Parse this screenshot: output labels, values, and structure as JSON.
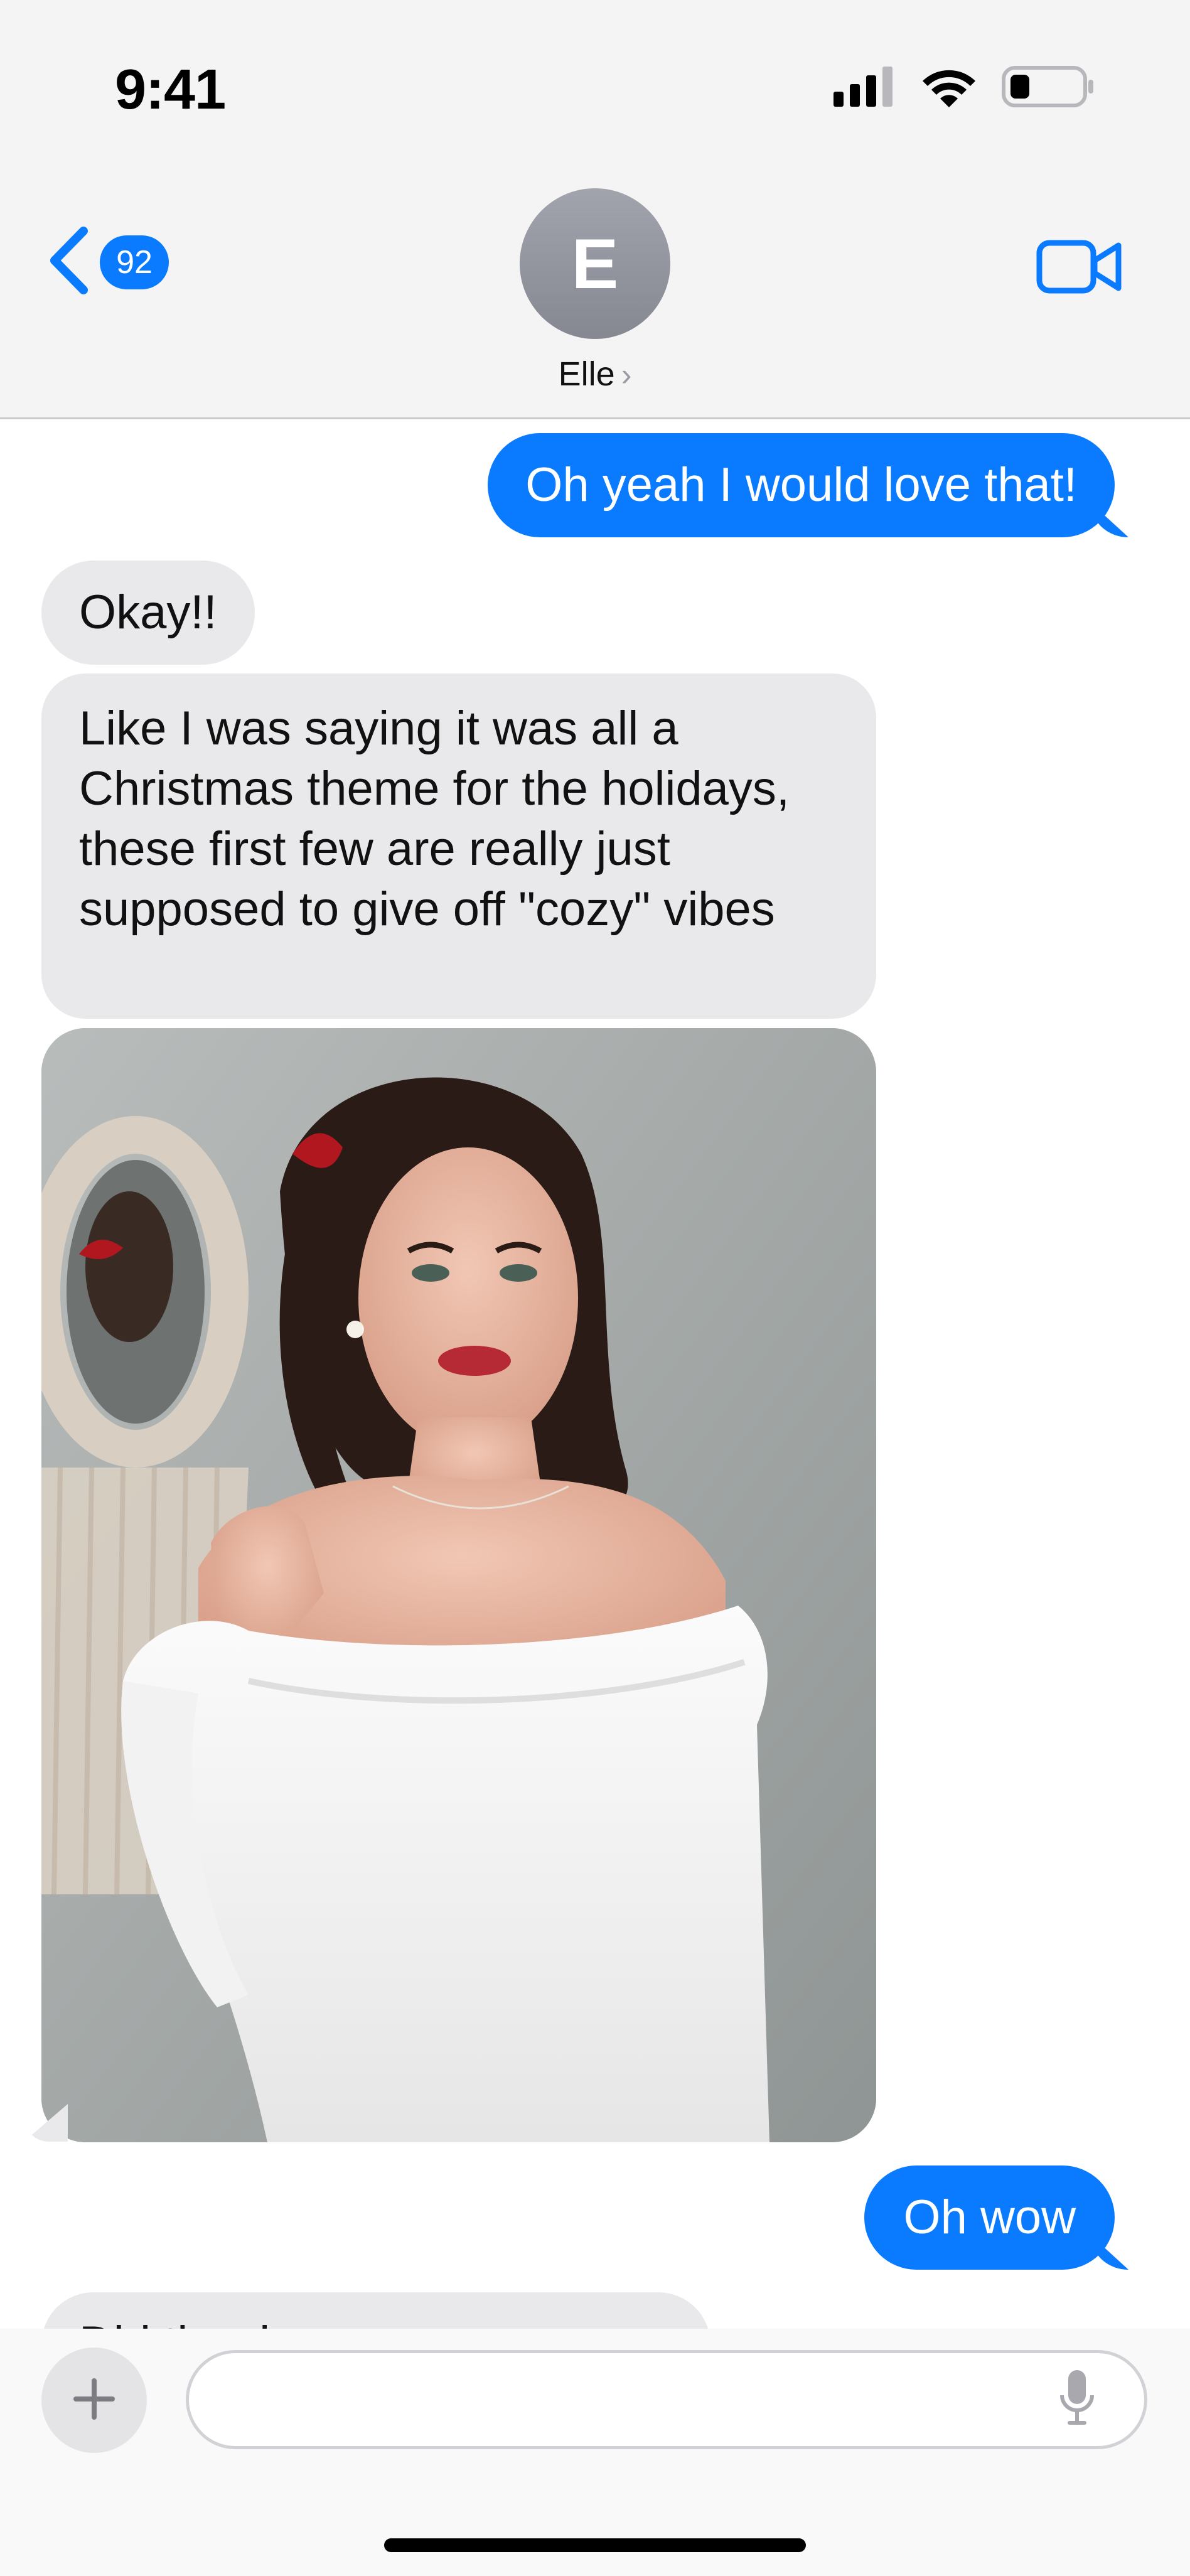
{
  "status_bar": {
    "time": "9:41",
    "icons": [
      "cellular-signal-icon",
      "wifi-icon",
      "battery-icon"
    ]
  },
  "nav": {
    "back_count": "92",
    "avatar_initial": "E",
    "contact_name": "Elle",
    "chevron": "›",
    "video_icon": "video-camera-icon"
  },
  "messages": [
    {
      "direction": "sent",
      "text": "Oh yeah I would love that!"
    },
    {
      "direction": "received",
      "text": "Okay!!"
    },
    {
      "direction": "received",
      "text": "Like I was saying it was all a Christmas theme for the holidays, these first few are really just supposed to give off \"cozy\" vibes"
    },
    {
      "direction": "received",
      "type": "photo"
    },
    {
      "direction": "sent",
      "text": "Oh wow"
    },
    {
      "direction": "received",
      "text": "Did the dress …",
      "partially_hidden": true
    }
  ],
  "composer": {
    "plus_icon": "plus-icon",
    "placeholder": "",
    "mic_icon": "microphone-icon"
  },
  "colors": {
    "sent_bubble": "#0a7aff",
    "received_bubble": "#e9e9eb",
    "header_bg": "#f4f4f5"
  }
}
